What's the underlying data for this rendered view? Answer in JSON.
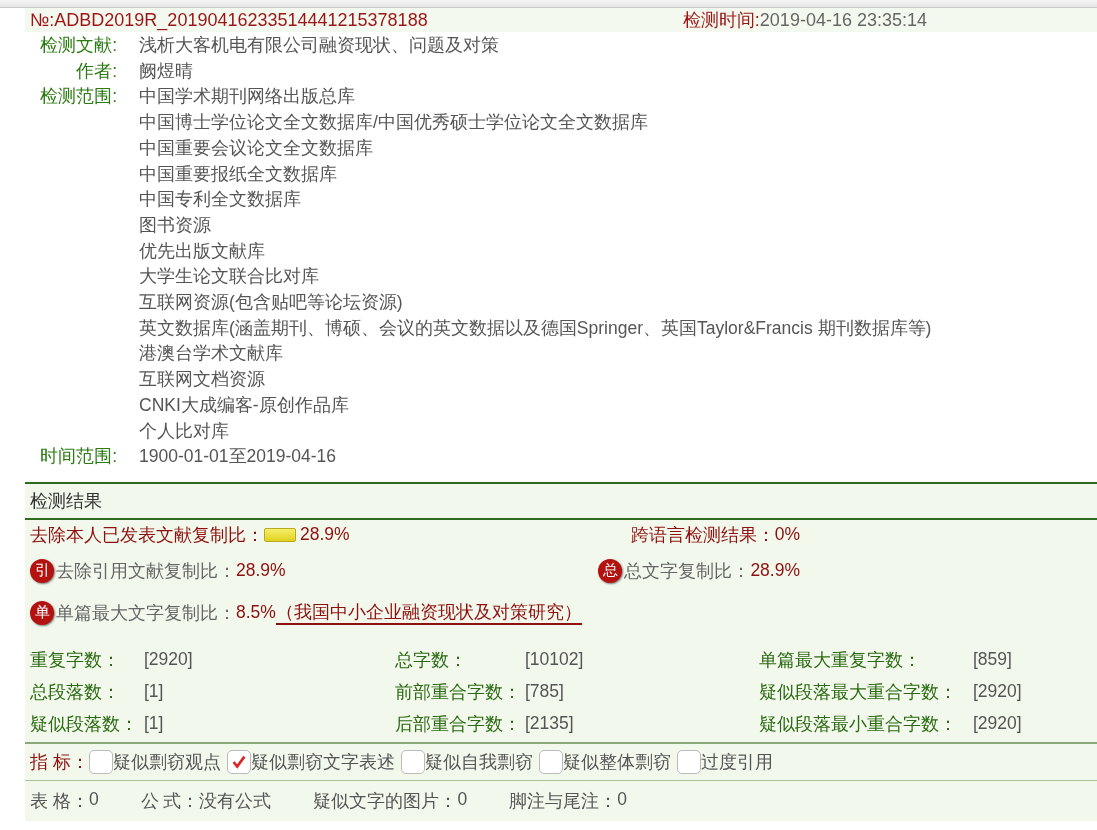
{
  "header": {
    "number": "№:ADBD2019R_20190416233514441215378188",
    "time_label": "检测时间:",
    "time_value": "2019-04-16 23:35:14"
  },
  "fields": [
    {
      "label": "检测文献:",
      "values": [
        "浅析大客机电有限公司融资现状、问题及对策"
      ]
    },
    {
      "label": "作者:",
      "values": [
        "阙煜晴"
      ]
    },
    {
      "label": "检测范围:",
      "values": [
        "中国学术期刊网络出版总库",
        "中国博士学位论文全文数据库/中国优秀硕士学位论文全文数据库",
        "中国重要会议论文全文数据库",
        "中国重要报纸全文数据库",
        "中国专利全文数据库",
        "图书资源",
        "优先出版文献库",
        "大学生论文联合比对库",
        "互联网资源(包含贴吧等论坛资源)",
        "英文数据库(涵盖期刊、博硕、会议的英文数据以及德国Springer、英国Taylor&Francis 期刊数据库等)",
        "港澳台学术文献库",
        "互联网文档资源",
        "CNKI大成编客-原创作品库",
        "个人比对库"
      ]
    },
    {
      "label": "时间范围:",
      "values": [
        "1900-01-01至2019-04-16"
      ]
    }
  ],
  "results": {
    "title": "检测结果",
    "main": {
      "label": "去除本人已发表文献复制比：",
      "value": "28.9%"
    },
    "cross": {
      "label": "跨语言检测结果：",
      "value": "0%"
    },
    "quoted": {
      "badge": "引",
      "label": "去除引用文献复制比：",
      "value": "28.9%"
    },
    "total": {
      "badge": "总",
      "label": "总文字复制比：",
      "value": "28.9%"
    },
    "single": {
      "badge": "单",
      "label": "单篇最大文字复制比：",
      "value": "8.5%",
      "link": "（我国中小企业融资现状及对策研究）"
    },
    "stats": [
      {
        "label": "重复字数：",
        "value": "[2920]"
      },
      {
        "label": "总字数：",
        "value": "[10102]"
      },
      {
        "label": "单篇最大重复字数：",
        "value": "[859]"
      },
      {
        "label": "总段落数：",
        "value": "[1]"
      },
      {
        "label": "前部重合字数：",
        "value": "[785]"
      },
      {
        "label": "疑似段落最大重合字数：",
        "value": "[2920]"
      },
      {
        "label": "疑似段落数：",
        "value": "[1]"
      },
      {
        "label": "后部重合字数：",
        "value": "[2135]"
      },
      {
        "label": "疑似段落最小重合字数：",
        "value": "[2920]"
      }
    ],
    "indicators": {
      "label": "指 标：",
      "items": [
        {
          "label": "疑似剽窃观点",
          "checked": false
        },
        {
          "label": "疑似剽窃文字表述",
          "checked": true
        },
        {
          "label": "疑似自我剽窃",
          "checked": false
        },
        {
          "label": "疑似整体剽窃",
          "checked": false
        },
        {
          "label": "过度引用",
          "checked": false
        }
      ]
    },
    "footer": [
      {
        "label": "表 格：",
        "value": "0"
      },
      {
        "label": "公 式：",
        "value": "没有公式"
      },
      {
        "label": "疑似文字的图片：",
        "value": "0"
      },
      {
        "label": "脚注与尾注：",
        "value": "0"
      }
    ]
  }
}
